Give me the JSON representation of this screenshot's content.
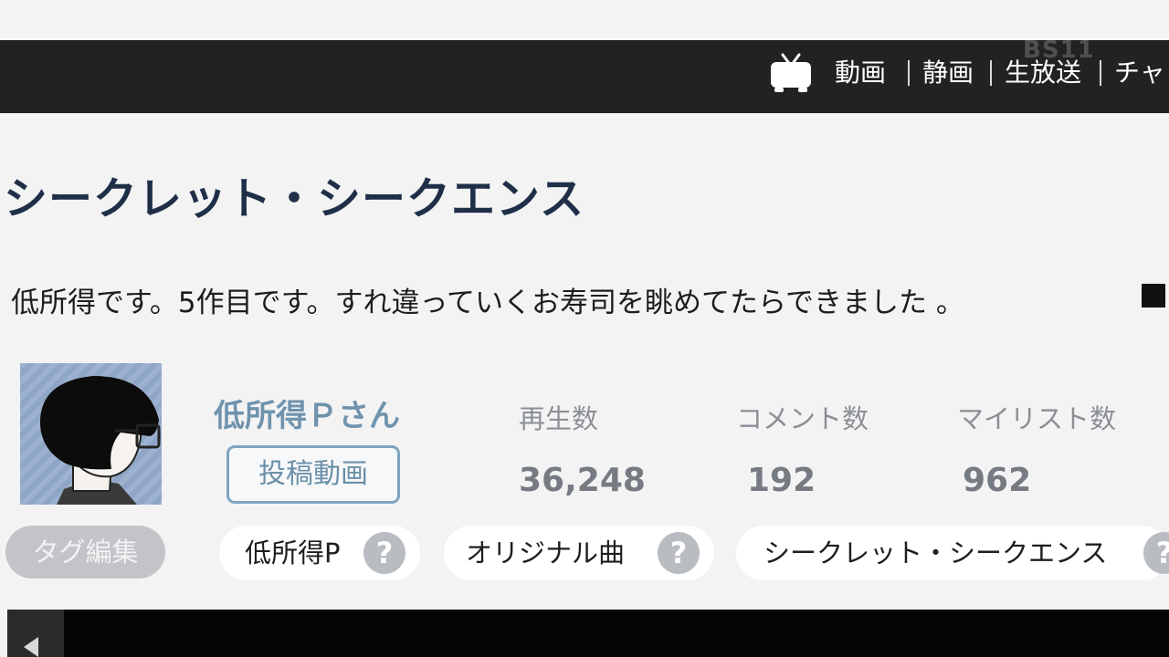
{
  "header": {
    "icon": "tv-icon",
    "nav": [
      "動画",
      "静画",
      "生放送",
      "チャ"
    ],
    "watermark": "BS11"
  },
  "video": {
    "title": "シークレット・シークエンス",
    "description": "低所得です。5作目です。すれ違っていくお寿司を眺めてたらできました 。"
  },
  "uploader": {
    "name": "低所得Ｐさん",
    "posted_videos_button": "投稿動画"
  },
  "stats": {
    "views_label": "再生数",
    "views": "36,248",
    "comments_label": "コメント数",
    "comments": "192",
    "mylist_label": "マイリスト数",
    "mylist": "962"
  },
  "tags": {
    "edit_button": "タグ編集",
    "items": [
      "低所得P",
      "オリジナル曲",
      "シークレット・シークエンス"
    ],
    "help_glyph": "?"
  },
  "colors": {
    "nav_bg": "#222222",
    "title": "#1f2f48",
    "uploader": "#6f93ad",
    "stats": "#767b82"
  }
}
